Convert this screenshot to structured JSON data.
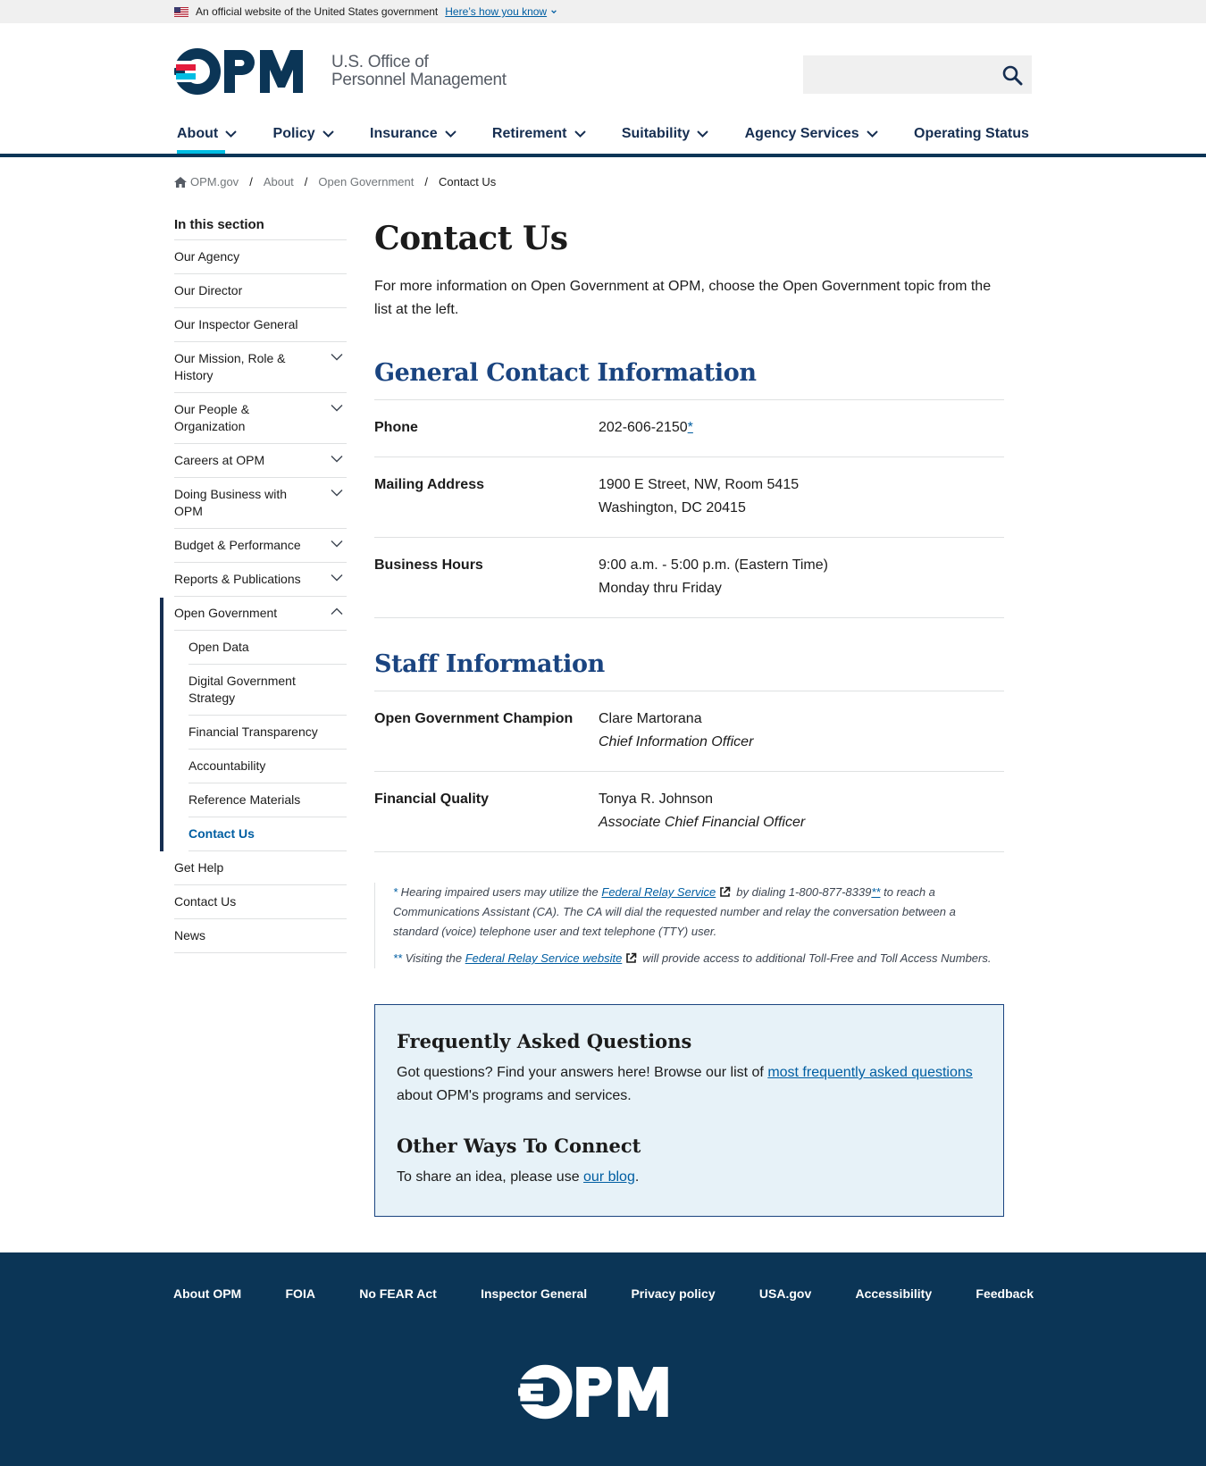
{
  "gov_banner": {
    "text": "An official website of the United States government",
    "link": "Here’s how you know"
  },
  "header": {
    "logo_text": "OPM",
    "org_line1": "U.S. Office of",
    "org_line2": "Personnel Management",
    "search_placeholder": ""
  },
  "nav": {
    "items": [
      "About",
      "Policy",
      "Insurance",
      "Retirement",
      "Suitability",
      "Agency Services",
      "Operating Status"
    ]
  },
  "breadcrumb": {
    "home": "OPM.gov",
    "items": [
      "About",
      "Open Government"
    ],
    "current": "Contact Us"
  },
  "sidebar": {
    "heading": "In this section",
    "items": [
      "Our Agency",
      "Our Director",
      "Our Inspector General",
      "Our Mission, Role & History",
      "Our People & Organization",
      "Careers at OPM",
      "Doing Business with OPM",
      "Budget & Performance",
      "Reports & Publications",
      "Open Government"
    ],
    "sub_items": [
      "Open Data",
      "Digital Government Strategy",
      "Financial Transparency",
      "Accountability",
      "Reference Materials",
      "Contact Us"
    ],
    "after_items": [
      "Get Help",
      "Contact Us",
      "News"
    ]
  },
  "main": {
    "title": "Contact Us",
    "intro": "For more information on Open Government at OPM, choose the Open Government topic from the list at the left.",
    "general_heading": "General Contact Information",
    "general": {
      "phone_label": "Phone",
      "phone_value": "202-606-2150",
      "phone_mark": "*",
      "mail_label": "Mailing Address",
      "mail_line1": "1900 E Street, NW, Room 5415",
      "mail_line2": "Washington, DC 20415",
      "hours_label": "Business Hours",
      "hours_line1": "9:00 a.m. - 5:00 p.m. (Eastern Time)",
      "hours_line2": "Monday thru Friday"
    },
    "staff_heading": "Staff Information",
    "staff": {
      "champion_label": "Open Government Champion",
      "champion_name": "Clare Martorana",
      "champion_title": "Chief Information Officer",
      "quality_label": "Financial Quality",
      "quality_name": "Tonya R. Johnson",
      "quality_title": "Associate Chief Financial Officer"
    },
    "footnotes": {
      "fn1_mark": "*",
      "fn1_pre": " Hearing impaired users may utilize the ",
      "fn1_link": "Federal Relay Service",
      "fn1_mid": "by dialing 1-800-877-8339",
      "fn1_mark2": "**",
      "fn1_post": " to reach a Communications Assistant (CA). The CA will dial the requested number and relay the conversation between a standard (voice) telephone user and text telephone (TTY) user.",
      "fn2_mark": "**",
      "fn2_pre": " Visiting the ",
      "fn2_link": "Federal Relay Service website",
      "fn2_post": "will provide access to additional Toll-Free and Toll Access Numbers."
    },
    "faq": {
      "heading": "Frequently Asked Questions",
      "text_pre": "Got questions? Find your answers here! Browse our list of ",
      "link": "most frequently asked questions",
      "text_post": " about OPM's programs and services.",
      "heading2": "Other Ways To Connect",
      "text2_pre": "To share an idea, please use ",
      "link2": "our blog",
      "text2_post": "."
    }
  },
  "footer": {
    "links": [
      "About OPM",
      "FOIA",
      "No FEAR Act",
      "Inspector General",
      "Privacy policy",
      "USA.gov",
      "Accessibility",
      "Feedback"
    ],
    "logo_text": "OPM"
  },
  "colors": {
    "navy": "#0b3556",
    "brand_red": "#e31c3d",
    "brand_blue": "#00bde3",
    "link": "#005ea2",
    "faq_bg": "#e7f2f8"
  }
}
